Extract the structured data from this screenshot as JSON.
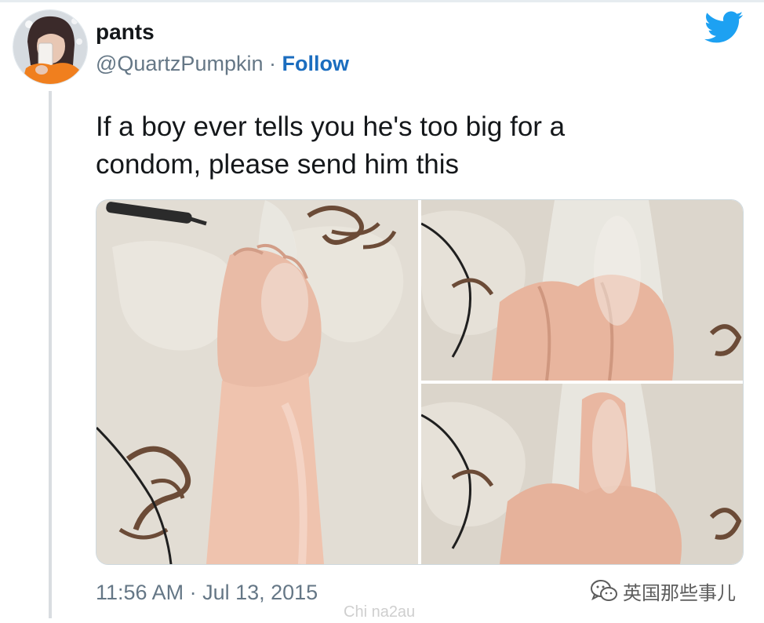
{
  "tweet": {
    "author": {
      "display_name": "pants",
      "handle": "@QuartzPumpkin",
      "separator": "·",
      "follow_label": "Follow"
    },
    "text_lines": [
      "If a boy ever tells you he's too big for a",
      "condom, please send him this"
    ],
    "timestamp": "11:56 AM · Jul 13, 2015",
    "media": [
      {
        "name": "photo-fist-in-condom"
      },
      {
        "name": "photo-knuckles-closeup"
      },
      {
        "name": "photo-middle-finger"
      }
    ]
  },
  "icons": {
    "brand": "twitter-bird-icon",
    "wechat": "wechat-icon"
  },
  "colors": {
    "twitter_blue": "#1da1f2",
    "follow_link": "#1b6dbf",
    "secondary_text": "#657786",
    "primary_text": "#14171a"
  },
  "watermark": {
    "account_name": "英国那些事儿",
    "site": "Chi na2au"
  }
}
